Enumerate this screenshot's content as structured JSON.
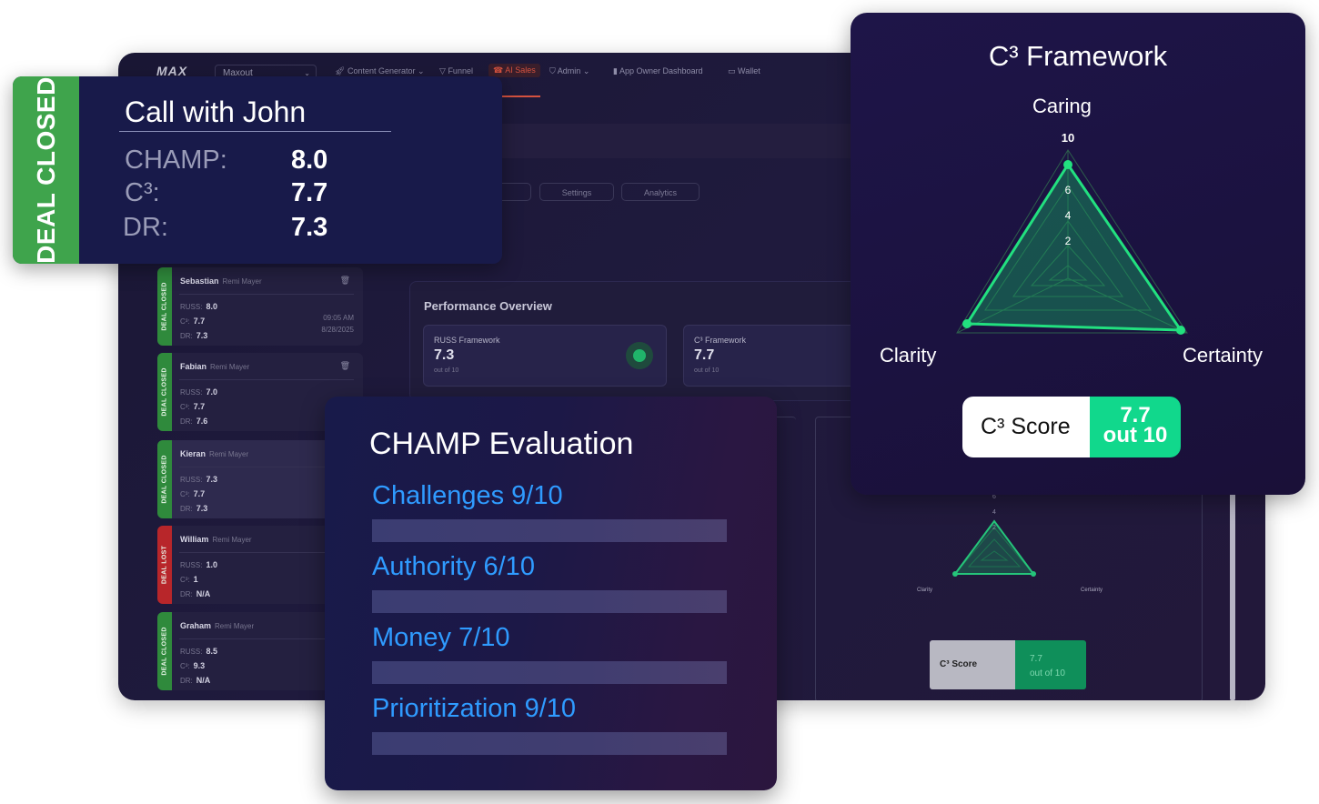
{
  "nav": {
    "logo": "MAX",
    "workspace": "Maxout",
    "items": [
      {
        "label": "Content Generator",
        "icon": "rocket-icon",
        "chevron": true
      },
      {
        "label": "Funnel",
        "icon": "funnel-icon",
        "chevron": false
      },
      {
        "label": "AI Sales",
        "icon": "phone-icon",
        "chevron": false,
        "active": true
      },
      {
        "label": "Admin",
        "icon": "shield-icon",
        "chevron": true
      },
      {
        "label": "App Owner Dashboard",
        "icon": "bookmark-icon",
        "chevron": false
      },
      {
        "label": "Wallet",
        "icon": "wallet-icon",
        "chevron": false
      }
    ]
  },
  "tabs": [
    "Settings",
    "Analytics"
  ],
  "calls": [
    {
      "status": "DEAL CLOSED",
      "name": "Sebastian",
      "agent": "Remi Mayer",
      "russ_label": "RUSS:",
      "russ": "8.0",
      "c3_label": "C³:",
      "c3": "7.7",
      "dr_label": "DR:",
      "dr": "7.3",
      "time": "09:05 AM",
      "date": "8/28/2025"
    },
    {
      "status": "DEAL CLOSED",
      "name": "Fabian",
      "agent": "Remi Mayer",
      "russ_label": "RUSS:",
      "russ": "7.0",
      "c3_label": "C³:",
      "c3": "7.7",
      "dr_label": "DR:",
      "dr": "7.6"
    },
    {
      "status": "DEAL CLOSED",
      "name": "Kieran",
      "agent": "Remi Mayer",
      "russ_label": "RUSS:",
      "russ": "7.3",
      "c3_label": "C³:",
      "c3": "7.7",
      "dr_label": "DR:",
      "dr": "7.3"
    },
    {
      "status": "DEAL LOST",
      "name": "William",
      "agent": "Remi Mayer",
      "russ_label": "RUSS:",
      "russ": "1.0",
      "c3_label": "C³:",
      "c3": "1",
      "dr_label": "DR:",
      "dr": "N/A"
    },
    {
      "status": "DEAL CLOSED",
      "name": "Graham",
      "agent": "Remi Mayer",
      "russ_label": "RUSS:",
      "russ": "8.5",
      "c3_label": "C³:",
      "c3": "9.3",
      "dr_label": "DR:",
      "dr": "N/A"
    }
  ],
  "performance": {
    "title": "Performance Overview",
    "metrics": [
      {
        "label": "RUSS Framework",
        "value": "7.3",
        "sub": "out of 10"
      },
      {
        "label": "C³ Framework",
        "value": "7.7",
        "sub": "out of 10"
      }
    ]
  },
  "mini_chart": {
    "labels": {
      "left": "Clarity",
      "right": "Certainty"
    },
    "ticks": [
      "6",
      "4",
      "2"
    ],
    "score_label": "C³ Score",
    "score_value": "7.7",
    "score_sub": "out of 10"
  },
  "john_card": {
    "status": "DEAL CLOSED",
    "title": "Call with John",
    "rows": [
      {
        "label": "CHAMP:",
        "value": "8.0"
      },
      {
        "label": "C³:",
        "value": "7.7"
      },
      {
        "label": "DR:",
        "value": "7.3"
      }
    ]
  },
  "c3_card": {
    "title": "C³ Framework",
    "axes": {
      "top": "Caring",
      "left": "Clarity",
      "right": "Certainty"
    },
    "ticks": [
      "10",
      "6",
      "4",
      "2"
    ],
    "score_label": "C³ Score",
    "score_value": "7.7",
    "score_sub": "out 10"
  },
  "champ_card": {
    "title": "CHAMP Evaluation",
    "items": [
      {
        "label": "Challenges 9/10"
      },
      {
        "label": "Authority 6/10"
      },
      {
        "label": "Money 7/10"
      },
      {
        "label": "Prioritization 9/10"
      }
    ]
  },
  "colors": {
    "closed": "#3fa44c",
    "lost": "#b8262a",
    "accent_green": "#11d88c",
    "champ_blue": "#2f9bff",
    "nav_active": "#d5523f"
  }
}
